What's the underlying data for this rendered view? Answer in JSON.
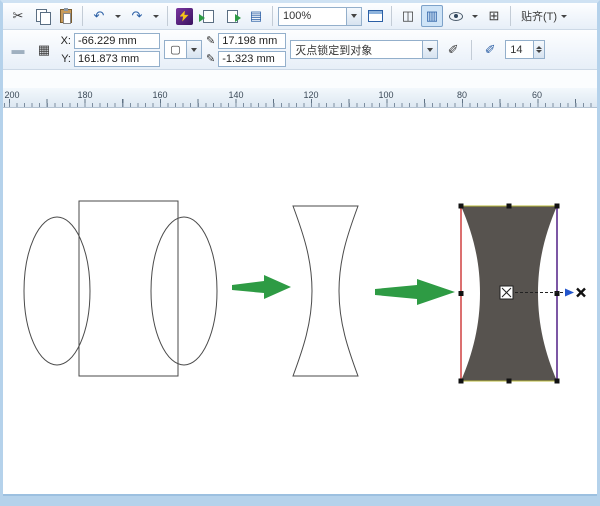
{
  "toolbar_main": {
    "cut_glyph": "✂",
    "undo_glyph": "↶",
    "redo_glyph": "↷",
    "app_grid_glyph": "▤",
    "view1_glyph": "◫",
    "view2_glyph": "▥",
    "grid_glyph": "⊞",
    "zoom_value": "100%",
    "snap_label": "贴齐(T)"
  },
  "property_bar": {
    "inactive_glyph": "▬",
    "position_glyph": "▦",
    "page_glyph": "▢",
    "pencil_glyph": "✎",
    "pen_glyph": "✐",
    "x_label": "X:",
    "x_value": "-66.229 mm",
    "y_label": "Y:",
    "y_value": "161.873 mm",
    "w_value": "17.198 mm",
    "h_value": "-1.323 mm",
    "vp_mode": "灭点锁定到对象",
    "depth_value": "14"
  },
  "ruler": {
    "labels": [
      "200",
      "180",
      "160",
      "140",
      "120",
      "100",
      "80",
      "60"
    ]
  },
  "canvas": {
    "outline_color": "#4a4a4a",
    "arrow_color": "#2e9b44",
    "shape_fill": "#57534f",
    "sel_left_color": "#cc3333",
    "sel_right_color": "#5b2d8e",
    "sel_hline_color": "#b9b93a",
    "handle_color": "#111111",
    "vp_arrow_color": "#2255cc"
  }
}
